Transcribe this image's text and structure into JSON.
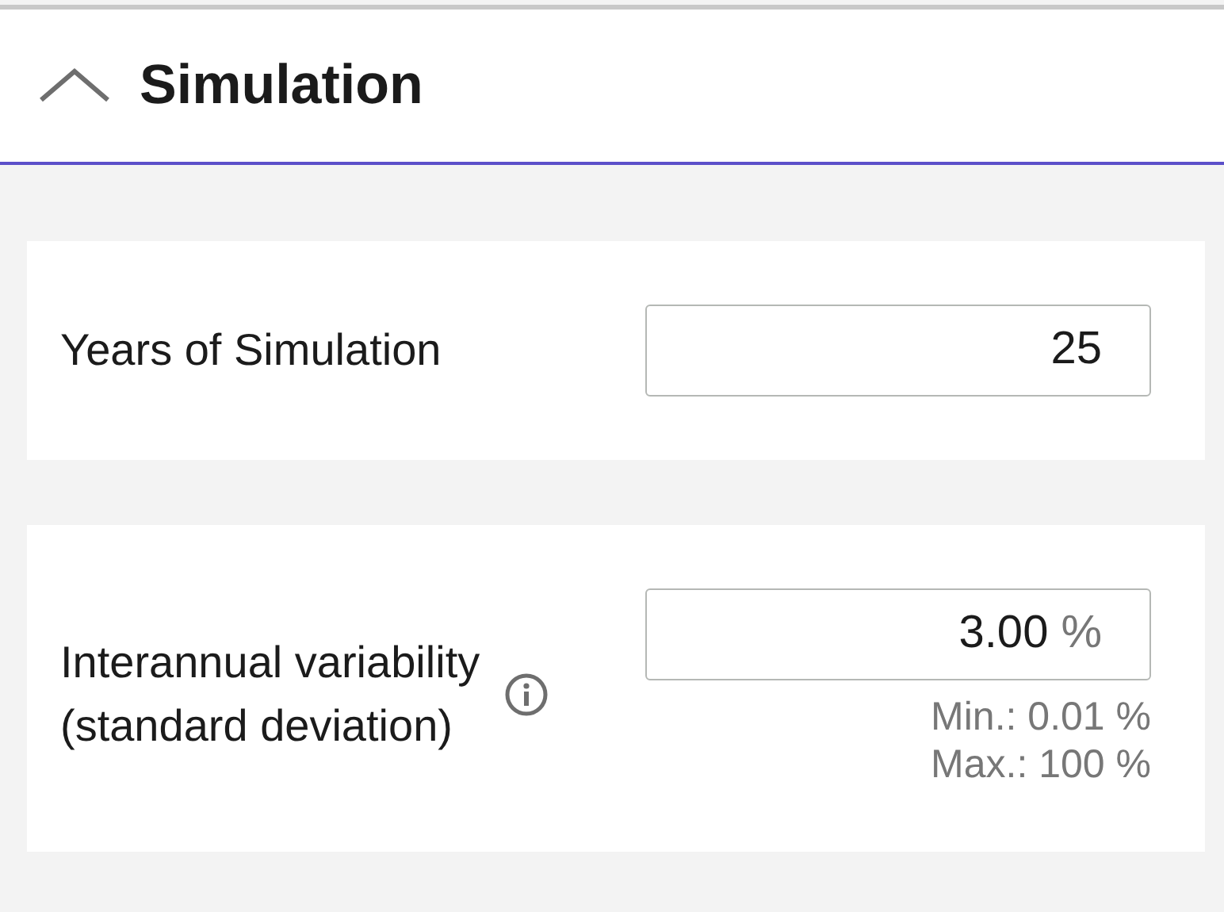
{
  "section": {
    "title": "Simulation",
    "expanded": true
  },
  "fields": [
    {
      "kind": "plain",
      "label": "Years of Simulation",
      "value": "25"
    },
    {
      "kind": "percent",
      "label": "Interannual variability (standard deviation)",
      "value": "3.00",
      "unit": "%",
      "info": true,
      "min": "Min.: 0.01 %",
      "max": "Max.: 100 %"
    }
  ]
}
